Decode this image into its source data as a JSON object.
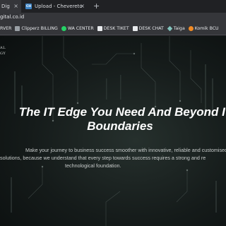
{
  "browser": {
    "tabs": [
      {
        "title": "Dig",
        "active": true
      },
      {
        "title": "Upload - Chevereto",
        "favicon_text": "CH",
        "active": false
      }
    ],
    "new_tab_label": "+",
    "address": "gital.co.id",
    "bookmarks": [
      {
        "label": "RVER",
        "icon": "doc-icon"
      },
      {
        "label": "Clipperz BILLING",
        "icon": "doc-icon"
      },
      {
        "label": "WA CENTER",
        "icon": "whatsapp-icon"
      },
      {
        "label": "DESK TIKET",
        "icon": "monitor-icon"
      },
      {
        "label": "DESK CHAT",
        "icon": "monitor-icon"
      },
      {
        "label": "Taiga",
        "icon": "taiga-icon"
      },
      {
        "label": "Komik BCU",
        "icon": "bcu-icon"
      }
    ]
  },
  "hero": {
    "logo_line1": "AL",
    "logo_line2": "GY",
    "headline_line1": "The IT Edge You Need And Beyond IT",
    "headline_line2": "Boundaries",
    "sub_line1": "Make your journey to business success smoother with innovative, reliable and customised",
    "sub_line2": "solutions, because we understand that every step towards success requires a strong and re",
    "sub_line3": "technological foundation."
  }
}
